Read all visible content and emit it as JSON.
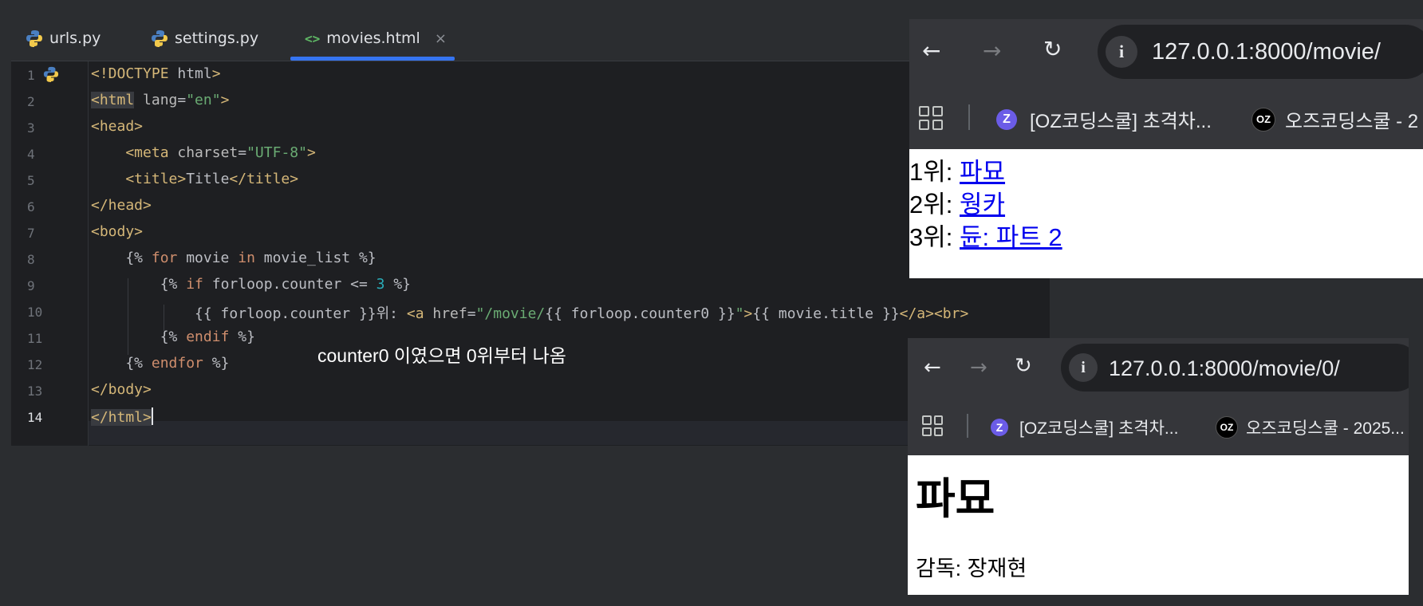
{
  "ide": {
    "tabs": [
      {
        "label": "urls.py",
        "icon": "python-icon"
      },
      {
        "label": "settings.py",
        "icon": "python-icon"
      },
      {
        "label": "movies.html",
        "icon": "html-icon",
        "active": true
      }
    ],
    "active_tab_close": "×",
    "line_numbers": [
      "1",
      "2",
      "3",
      "4",
      "5",
      "6",
      "7",
      "8",
      "9",
      "10",
      "11",
      "12",
      "13",
      "14"
    ],
    "current_line": "14",
    "code": {
      "l1_a": "<!DOCTYPE",
      "l1_b": " html",
      "l1_c": ">",
      "l2_a": "<html",
      "l2_b": " lang",
      "l2_c": "=",
      "l2_d": "\"en\"",
      "l2_e": ">",
      "l3": "<head>",
      "l4_a": "    <meta",
      "l4_b": " charset",
      "l4_c": "=",
      "l4_d": "\"UTF-8\"",
      "l4_e": ">",
      "l5_a": "    <title>",
      "l5_b": "Title",
      "l5_c": "</title>",
      "l6": "</head>",
      "l7": "<body>",
      "l8_a": "    {% ",
      "l8_b": "for",
      "l8_c": " movie ",
      "l8_d": "in",
      "l8_e": " movie_list %}",
      "l9_a": "        {% ",
      "l9_b": "if",
      "l9_c": " forloop.counter <= ",
      "l9_d": "3",
      "l9_e": " %}",
      "l10_a": "            {{ forloop.counter }}위: ",
      "l10_b": "<a",
      "l10_c": " href",
      "l10_d": "=",
      "l10_e": "\"/movie/",
      "l10_f": "{{ forloop.counter0 }}",
      "l10_g": "\"",
      "l10_h": ">",
      "l10_i": "{{ movie.title }}",
      "l10_j": "</a><br>",
      "l11_a": "        {% ",
      "l11_b": "endif",
      "l11_c": " %}",
      "l12_a": "    {% ",
      "l12_b": "endfor",
      "l12_c": " %}",
      "l13": "</body>",
      "l14": "</html>"
    },
    "annotation": "counter0 이였으면 0위부터 나옴"
  },
  "browser_top": {
    "url": "127.0.0.1:8000/movie/",
    "bookmarks": [
      {
        "label": "[OZ코딩스쿨] 초격차...",
        "favicon": "z-favicon"
      },
      {
        "label": "오즈코딩스쿨 - 2",
        "favicon": "oz-favicon"
      }
    ],
    "list": [
      {
        "rank": "1위: ",
        "title": "파묘"
      },
      {
        "rank": "2위: ",
        "title": "웡카"
      },
      {
        "rank": "3위: ",
        "title": "듄: 파트 2"
      }
    ]
  },
  "browser_bottom": {
    "url": "127.0.0.1:8000/movie/0/",
    "bookmarks": [
      {
        "label": "[OZ코딩스쿨] 초격차...",
        "favicon": "z-favicon"
      },
      {
        "label": "오즈코딩스쿨 - 2025...",
        "favicon": "oz-favicon"
      }
    ],
    "heading": "파묘",
    "director": "감독: 장재현"
  },
  "colors": {
    "accent": "#3574f0",
    "tag": "#d5b778",
    "string": "#6aab73",
    "keyword": "#cf8e6d",
    "number": "#2aacb8",
    "link": "#0000ee"
  }
}
